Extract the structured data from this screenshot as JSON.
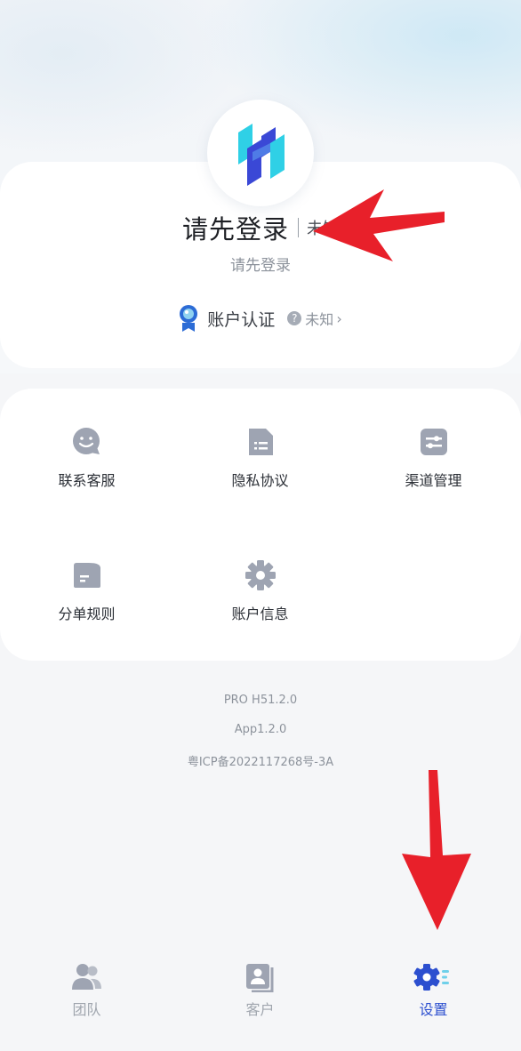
{
  "profile": {
    "name": "请先登录",
    "role": "未知",
    "subtitle": "请先登录",
    "certification": {
      "label": "账户认证",
      "status": "未知",
      "status_icon": "question-circle-icon"
    }
  },
  "menu": [
    {
      "label": "联系客服",
      "icon": "customer-service-chat-icon"
    },
    {
      "label": "隐私协议",
      "icon": "document-icon"
    },
    {
      "label": "渠道管理",
      "icon": "sliders-icon"
    },
    {
      "label": "分单规则",
      "icon": "folder-icon"
    },
    {
      "label": "账户信息",
      "icon": "gear-icon"
    }
  ],
  "footer": {
    "version_pro": "PRO H51.2.0",
    "version_app": "App1.2.0",
    "icp": "粤ICP备2022117268号-3A"
  },
  "tabs": [
    {
      "label": "团队",
      "icon": "team-icon",
      "active": false
    },
    {
      "label": "客户",
      "icon": "contacts-icon",
      "active": false
    },
    {
      "label": "设置",
      "icon": "settings-gear-icon",
      "active": true
    }
  ],
  "colors": {
    "accent": "#2c4fcf",
    "icon_gray": "#9ea4b2",
    "annotation_arrow": "#e8202a",
    "logo_cyan": "#2fd0e6",
    "logo_blue": "#3a48d6"
  }
}
